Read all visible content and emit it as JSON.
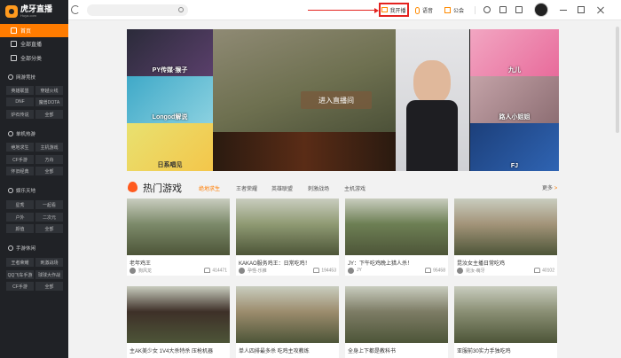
{
  "app": {
    "logo_text": "虎牙直播",
    "logo_sub": "Huya.com"
  },
  "sidebar": {
    "main_items": [
      {
        "label": "首页",
        "active": true
      },
      {
        "label": "全部直播",
        "active": false
      },
      {
        "label": "全部分类",
        "active": false
      }
    ],
    "sections": [
      {
        "title": "网游竞技",
        "tags": [
          "英雄联盟",
          "穿越火线",
          "DNF",
          "魔兽DOTA",
          "炉石传说",
          "全部"
        ]
      },
      {
        "title": "单机热游",
        "tags": [
          "绝地求生",
          "主机游戏",
          "CF手游",
          "方舟",
          "怀旧经典",
          "全部"
        ]
      },
      {
        "title": "娱乐天地",
        "tags": [
          "星秀",
          "一起看",
          "户外",
          "二次元",
          "颜值",
          "全部"
        ]
      },
      {
        "title": "手游休闲",
        "tags": [
          "王者荣耀",
          "刺激战场",
          "QQ飞车手游",
          "球球大作战",
          "CF手游",
          "全部"
        ]
      }
    ]
  },
  "topbar": {
    "search_placeholder": "",
    "open_live_label": "我开播",
    "voice_label": "语音",
    "guild_label": "公会"
  },
  "banner": {
    "enter_label": "进入直播间",
    "thumbs": [
      {
        "caption": "PY传媒·猴子"
      },
      {
        "caption": "Longod解说"
      },
      {
        "caption": "日系唱见"
      },
      {
        "caption": ""
      },
      {
        "caption": ""
      },
      {
        "caption": "路人小姐姐"
      },
      {
        "caption": "九儿"
      },
      {
        "caption": "FJ"
      }
    ]
  },
  "hot_games": {
    "title": "热门游戏",
    "tabs": [
      "绝地求生",
      "王者荣耀",
      "英雄联盟",
      "刺激战场",
      "主机游戏"
    ],
    "more_label": "更多",
    "more_arrow": ">"
  },
  "cards": [
    {
      "title": "老年鸡王",
      "streamer": "狗风龙",
      "viewers": "414471",
      "bg": "#7c8a6a"
    },
    {
      "title": "KAKAO服务鸡王：日常吃鸡！",
      "streamer": "孕怪-乐推",
      "viewers": "194453",
      "bg": "#8f9a73"
    },
    {
      "title": "JY：下午吃鸡晚上猎人杀！",
      "streamer": "JY",
      "viewers": "95458",
      "bg": "#6d7f54"
    },
    {
      "title": "昆汝女主播日常吃鸡",
      "streamer": "昆汝-萌牙",
      "viewers": "40102",
      "bg": "#a39479"
    },
    {
      "title": "主AK美少女 1V4大杀特杀 压枪机器",
      "streamer": "",
      "viewers": "",
      "bg": "#3e3028"
    },
    {
      "title": "单人四排最多杀 吃鸡主攻教练",
      "streamer": "",
      "viewers": "",
      "bg": "#9c8c6d"
    },
    {
      "title": "全身上下都是教科书",
      "streamer": "",
      "viewers": "",
      "bg": "#7d7c65"
    },
    {
      "title": "亚服前30实力手独吃鸡",
      "streamer": "",
      "viewers": "",
      "bg": "#8a8f74"
    }
  ]
}
